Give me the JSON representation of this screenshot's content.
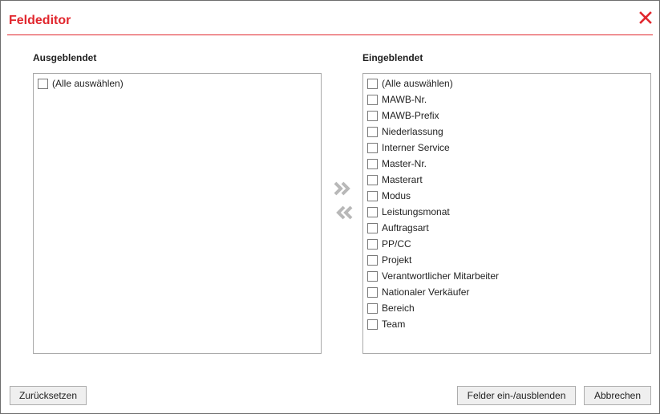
{
  "dialog": {
    "title": "Feldeditor",
    "title_color": "#e1262d"
  },
  "hidden": {
    "label": "Ausgeblendet",
    "items": [
      {
        "label": "(Alle auswählen)",
        "checked": false
      }
    ]
  },
  "shown": {
    "label": "Eingeblendet",
    "items": [
      {
        "label": "(Alle auswählen)",
        "checked": false
      },
      {
        "label": "MAWB-Nr.",
        "checked": false
      },
      {
        "label": "MAWB-Prefix",
        "checked": false
      },
      {
        "label": "Niederlassung",
        "checked": false
      },
      {
        "label": "Interner Service",
        "checked": false
      },
      {
        "label": "Master-Nr.",
        "checked": false
      },
      {
        "label": "Masterart",
        "checked": false
      },
      {
        "label": "Modus",
        "checked": false
      },
      {
        "label": "Leistungsmonat",
        "checked": false
      },
      {
        "label": "Auftragsart",
        "checked": false
      },
      {
        "label": "PP/CC",
        "checked": false
      },
      {
        "label": "Projekt",
        "checked": false
      },
      {
        "label": "Verantwortlicher Mitarbeiter",
        "checked": false
      },
      {
        "label": "Nationaler Verkäufer",
        "checked": false
      },
      {
        "label": "Bereich",
        "checked": false
      },
      {
        "label": "Team",
        "checked": false
      }
    ]
  },
  "buttons": {
    "reset": "Zurücksetzen",
    "apply": "Felder ein-/ausblenden",
    "cancel": "Abbrechen"
  },
  "icons": {
    "close": "close-icon",
    "move_right": "double-chevron-right-icon",
    "move_left": "double-chevron-left-icon"
  }
}
